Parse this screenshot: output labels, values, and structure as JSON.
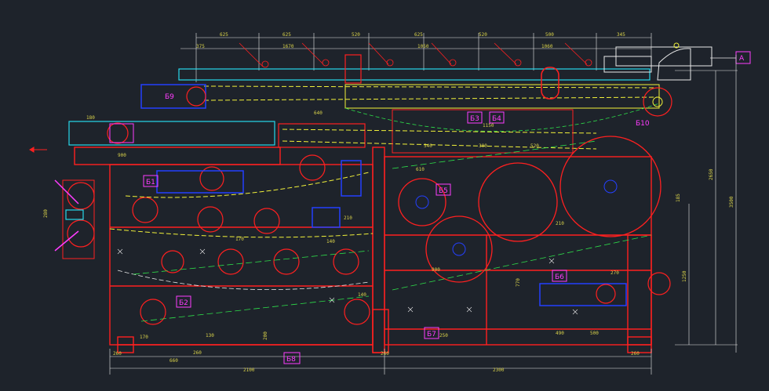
{
  "drawing": {
    "background": "#1e232b",
    "colors": {
      "frame": "#ff2020",
      "conveyor_top": "#f2f23a",
      "cyan": "#27d8ec",
      "blue": "#2440ff",
      "magenta": "#ff3cff",
      "white": "#e8e8e8",
      "green": "#2ee04a",
      "dim_text": "#d9d24a"
    },
    "top_dims": [
      "625",
      "625",
      "520",
      "625",
      "520",
      "500",
      "345"
    ],
    "top_dims_row2": [
      "375",
      "1670",
      "1050",
      "1060"
    ],
    "mid_dims": [
      "640",
      "1150",
      "540",
      "300",
      "520"
    ],
    "left_dims": [
      "900",
      "280"
    ],
    "right_dims": [
      "185",
      "2650",
      "1250",
      "3500"
    ],
    "bottom_dims": [
      "260",
      "2100",
      "260",
      "2300",
      "260",
      "660",
      "260",
      "170",
      "130",
      "140",
      "900",
      "770",
      "270",
      "490",
      "500",
      "200"
    ],
    "inner_dims": [
      "610",
      "210",
      "170",
      "140",
      "210",
      "250"
    ],
    "labels": [
      {
        "id": "b1",
        "text": "Б1"
      },
      {
        "id": "b2",
        "text": "Б2"
      },
      {
        "id": "b3",
        "text": "Б3"
      },
      {
        "id": "b4",
        "text": "Б4"
      },
      {
        "id": "b5",
        "text": "Б5"
      },
      {
        "id": "b6",
        "text": "Б6"
      },
      {
        "id": "b7",
        "text": "Б7"
      },
      {
        "id": "b8",
        "text": "Б8"
      },
      {
        "id": "b9",
        "text": "Б9"
      },
      {
        "id": "b10",
        "text": "Б10"
      },
      {
        "id": "a",
        "text": "А"
      }
    ]
  }
}
